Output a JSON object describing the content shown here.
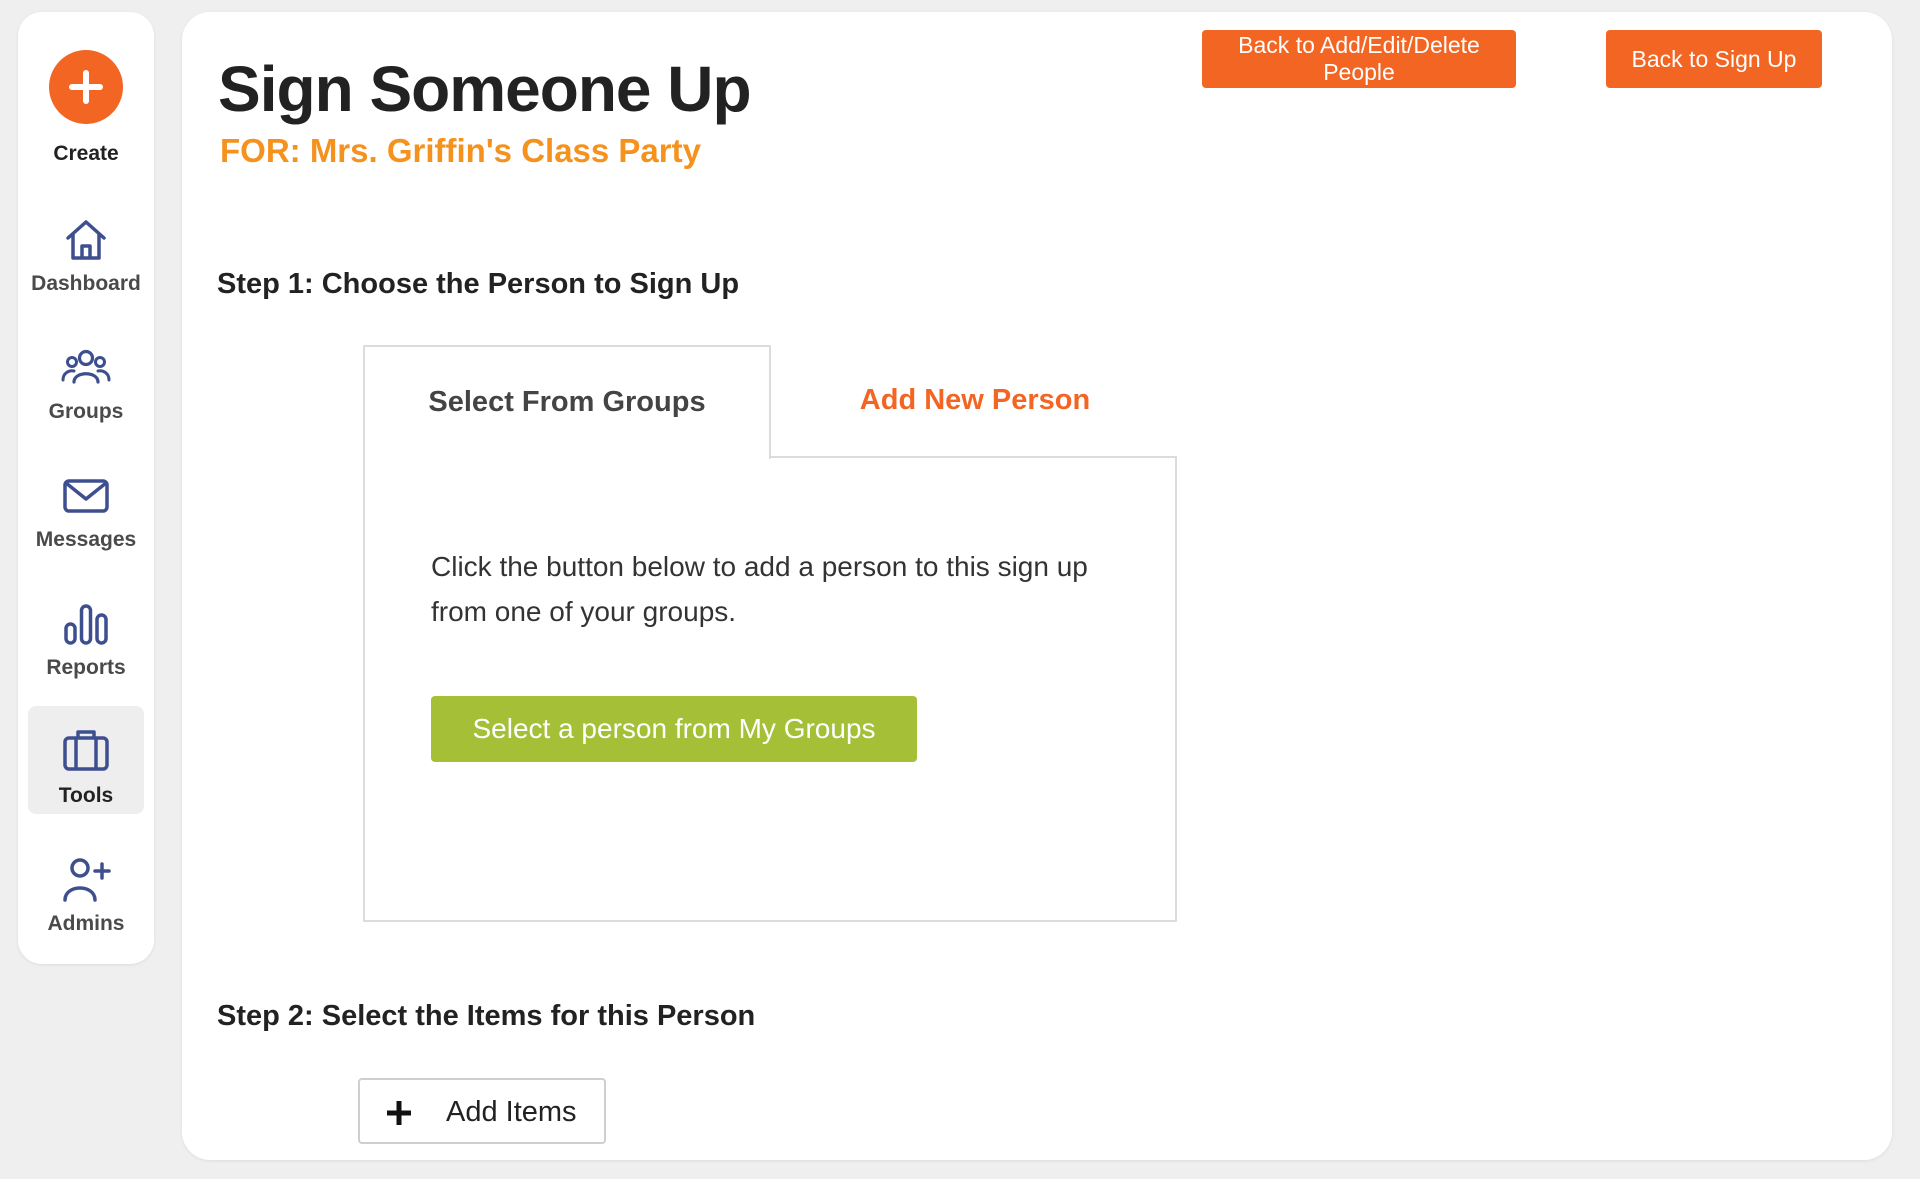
{
  "sidebar": {
    "create_label": "Create",
    "items": [
      {
        "id": "dashboard",
        "label": "Dashboard",
        "icon": "home-icon"
      },
      {
        "id": "groups",
        "label": "Groups",
        "icon": "people-icon"
      },
      {
        "id": "messages",
        "label": "Messages",
        "icon": "envelope-icon"
      },
      {
        "id": "reports",
        "label": "Reports",
        "icon": "bar-chart-icon"
      },
      {
        "id": "tools",
        "label": "Tools",
        "icon": "briefcase-icon",
        "active": true
      },
      {
        "id": "admins",
        "label": "Admins",
        "icon": "add-user-icon"
      }
    ]
  },
  "header": {
    "title": "Sign Someone Up",
    "subtitle": "FOR: Mrs. Griffin's Class Party",
    "back_people_label": "Back to Add/Edit/Delete People",
    "back_signup_label": "Back to Sign Up"
  },
  "step1": {
    "heading": "Step 1: Choose the Person to Sign Up",
    "tabs": [
      {
        "label": "Select From Groups",
        "active": true
      },
      {
        "label": "Add New Person",
        "active": false
      }
    ],
    "panel_text": "Click the button below to add a person to this sign up from one of your groups.",
    "select_button_label": "Select a person from My Groups"
  },
  "step2": {
    "heading": "Step 2: Select the Items for this Person",
    "add_items_label": "Add Items"
  },
  "colors": {
    "accent_orange": "#f26522",
    "subtitle_orange": "#f5921e",
    "green_button": "#a5bf37",
    "icon_blue": "#3d4f8f"
  }
}
